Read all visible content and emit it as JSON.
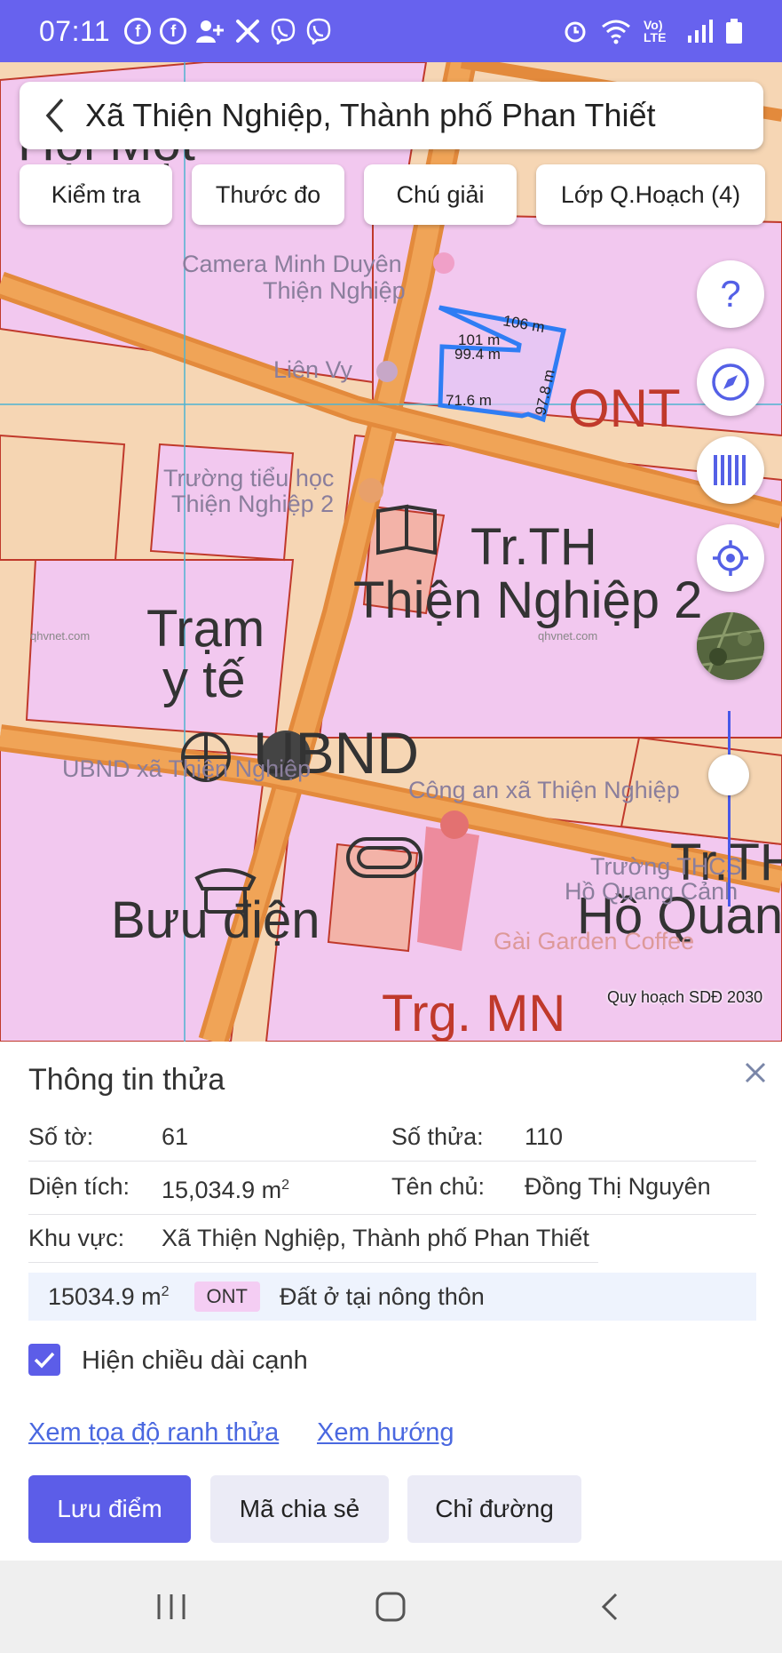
{
  "status_bar": {
    "time": "07:11",
    "left_icons": [
      "facebook-icon",
      "facebook-icon",
      "person-add-icon",
      "tools-icon",
      "viber-icon",
      "viber-icon"
    ],
    "right_icons": [
      "alarm-icon",
      "wifi-icon",
      "volte-icon",
      "signal-icon",
      "battery-icon"
    ],
    "volte_text": "Vo) LTE"
  },
  "search": {
    "title": "Xã Thiện Nghiệp, Thành phố Phan Thiết"
  },
  "toolbar": {
    "check_label": "Kiểm tra",
    "measure_label": "Thước đo",
    "legend_label": "Chú giải",
    "layers_label": "Lớp Q.Hoạch (4)"
  },
  "map": {
    "caption": "Quy hoạch SDĐ 2030",
    "labels": {
      "ont": "ONT",
      "school_line1": "Tr.TH",
      "school_line2": "Thiện Nghiệp 2",
      "tram_line1": "Trạm",
      "tram_line2": "y tế",
      "ubnd": "UBND",
      "buu_dien": "Bưu điện",
      "trg_mn": "Trg. MN",
      "ho_quang": "Hồ Quan",
      "tr_th_right": "Tr.TH",
      "top_left": "Hội Một",
      "camera_line1": "Camera Minh Duyên",
      "camera_line2": "Thiện Nghiệp",
      "lien_vy": "Liên Vy",
      "truong_tieu_hoc_1": "Trường tiểu học",
      "truong_tieu_hoc_2": "Thiện Nghiệp 2",
      "ubnd_xa": "UBND xã Thiện Nghiệp",
      "cong_an": "Công an xã Thiện Nghiệp",
      "truong_thcs_1": "Trường THCS",
      "truong_thcs_2": "Hồ Quang Cảnh",
      "garden": "Gài Garden Coffee",
      "watermark_1": "qhvnet.com",
      "watermark_2": "qhvnet.com"
    },
    "edge_lengths": {
      "top": "106 m",
      "inner_1": "101 m",
      "inner_2": "99.4 m",
      "right": "97.8 m",
      "bottom": "71.6 m"
    },
    "zoom_level": 0.8
  },
  "map_controls": [
    "help-icon",
    "compass-icon",
    "barcode-icon",
    "locate-icon",
    "satellite-layer-icon"
  ],
  "parcel": {
    "heading": "Thông tin thửa",
    "so_to_label": "Số tờ:",
    "so_to_value": "61",
    "so_thua_label": "Số thửa:",
    "so_thua_value": "110",
    "dien_tich_label": "Diện tích:",
    "dien_tich_value": "15,034.9 m",
    "ten_chu_label": "Tên chủ:",
    "ten_chu_value": "Đồng Thị Nguyên",
    "khu_vuc_label": "Khu vực:",
    "khu_vuc_value": "Xã Thiện Nghiệp, Thành phố Phan Thiết",
    "zone_area": "15034.9 m",
    "zone_code": "ONT",
    "zone_desc": "Đất ở tại nông thôn",
    "unit_superscript": "2",
    "show_edges_label": "Hiện chiều dài cạnh",
    "show_edges_checked": true,
    "link_coords": "Xem tọa độ ranh thửa",
    "link_direction": "Xem hướng",
    "btn_save": "Lưu điểm",
    "btn_share": "Mã chia sẻ",
    "btn_directions": "Chỉ đường"
  },
  "nav_bar": [
    "recent-apps-icon",
    "home-icon",
    "back-icon"
  ]
}
